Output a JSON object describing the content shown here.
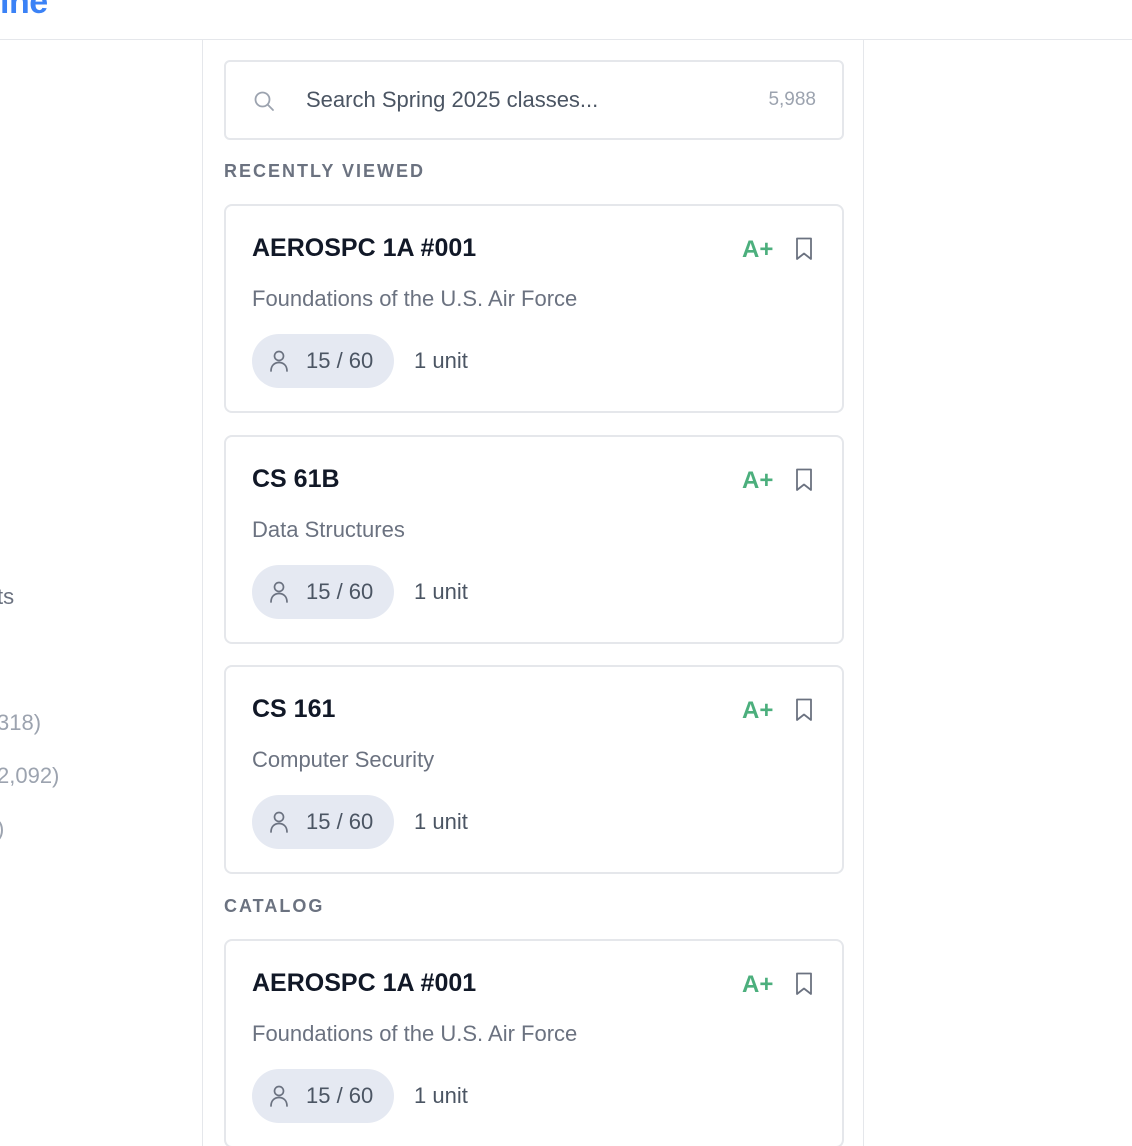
{
  "app": {
    "brand": "ine"
  },
  "left_panel": {
    "fragments": [
      "ts",
      "318)",
      "2,092)",
      ")"
    ]
  },
  "search": {
    "placeholder": "Search Spring 2025 classes...",
    "count": "5,988"
  },
  "sections": {
    "recent_label": "RECENTLY VIEWED",
    "catalog_label": "CATALOG"
  },
  "recent": [
    {
      "code": "AEROSPC 1A #001",
      "title": "Foundations of the U.S. Air Force",
      "grade": "A+",
      "enrollment": "15 / 60",
      "units": "1 unit"
    },
    {
      "code": "CS 61B",
      "title": "Data Structures",
      "grade": "A+",
      "enrollment": "15 / 60",
      "units": "1 unit"
    },
    {
      "code": "CS 161",
      "title": "Computer Security",
      "grade": "A+",
      "enrollment": "15 / 60",
      "units": "1 unit"
    }
  ],
  "catalog": [
    {
      "code": "AEROSPC 1A #001",
      "title": "Foundations of the U.S. Air Force",
      "grade": "A+",
      "enrollment": "15 / 60",
      "units": "1 unit"
    }
  ],
  "colors": {
    "brand": "#3b82f6",
    "grade": "#4caf7d",
    "pill_bg": "#e5e9f2",
    "border": "#e5e7eb"
  },
  "icons": {
    "search": "search-icon",
    "bookmark": "bookmark-icon",
    "person": "person-icon"
  }
}
